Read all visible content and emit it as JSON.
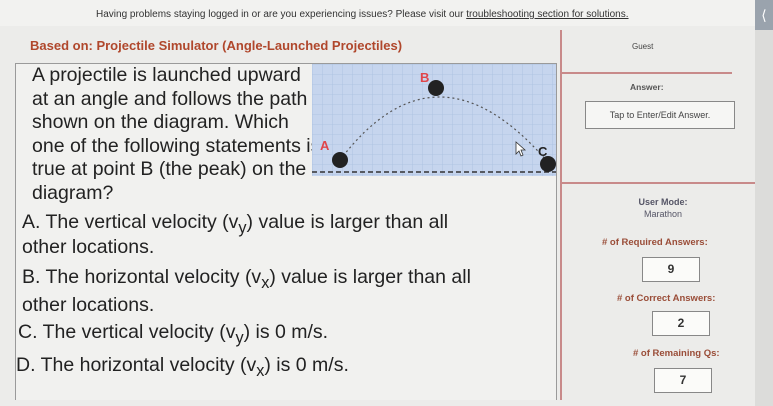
{
  "banner": {
    "message": "Having problems staying logged in or are you experiencing issues? Please visit our ",
    "link": "troubleshooting section for solutions."
  },
  "header": {
    "title": "Based on: Projectile Simulator (Angle-Launched Projectiles)",
    "guest_label": "Guest"
  },
  "question": {
    "stem": "A projectile is launched upward at an angle and follows the path shown on the diagram. Which one of the following statements is true at point B (the peak) on the diagram?",
    "options": [
      {
        "letter": "A.",
        "pre": "The vertical velocity (v",
        "sub": "y",
        "post": ") value is larger than all",
        "cont": "other locations."
      },
      {
        "letter": "B.",
        "pre": "The horizontal velocity (v",
        "sub": "x",
        "post": ") value is larger than all",
        "cont": "other locations."
      },
      {
        "letter": "C.",
        "pre": "The vertical velocity (v",
        "sub": "y",
        "post": ") is 0 m/s.",
        "cont": ""
      },
      {
        "letter": "D.",
        "pre": "The horizontal velocity (v",
        "sub": "x",
        "post": ") is 0 m/s.",
        "cont": ""
      }
    ]
  },
  "diagram": {
    "point_a": "A",
    "point_b": "B",
    "point_c": "C",
    "grid_color": "#a9bfe0",
    "background_color": "#c6d5ee",
    "label_color": "#e0454a"
  },
  "sidebar": {
    "answer_label": "Answer:",
    "answer_button": "Tap to Enter/Edit Answer.",
    "user_mode_label": "User Mode:",
    "user_mode_value": "Marathon",
    "required_label": "# of Required Answers:",
    "required_value": "9",
    "correct_label": "# of Correct Answers:",
    "correct_value": "2",
    "remaining_label": "# of Remaining Qs:",
    "remaining_value": "7"
  }
}
